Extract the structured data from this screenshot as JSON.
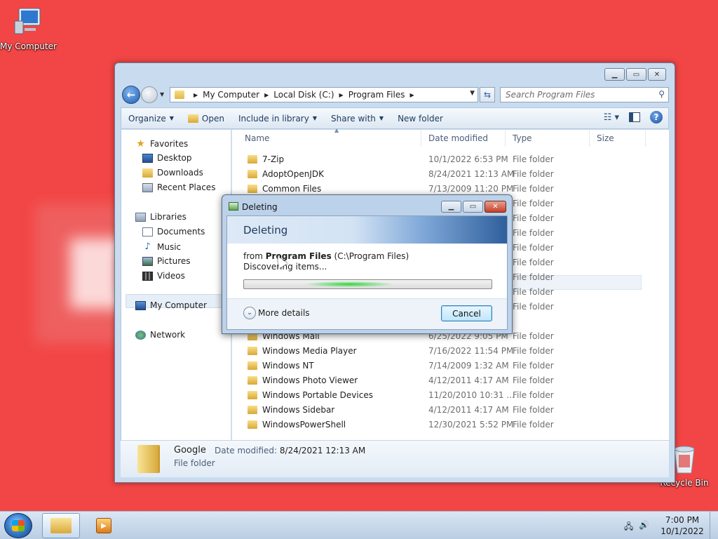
{
  "desktop": {
    "icons": [
      {
        "label": "My Computer"
      },
      {
        "label": "Recycle Bin"
      }
    ]
  },
  "explorer": {
    "address": {
      "crumbs": [
        "My Computer",
        "Local Disk (C:)",
        "Program Files"
      ]
    },
    "search": {
      "placeholder": "Search Program Files"
    },
    "toolbar": {
      "organize": "Organize",
      "open": "Open",
      "include_in_library": "Include in library",
      "share_with": "Share with",
      "new_folder": "New folder"
    },
    "nav": {
      "favorites": "Favorites",
      "desktop": "Desktop",
      "downloads": "Downloads",
      "recent_places": "Recent Places",
      "libraries": "Libraries",
      "documents": "Documents",
      "music": "Music",
      "pictures": "Pictures",
      "videos": "Videos",
      "my_computer": "My Computer",
      "network": "Network"
    },
    "columns": {
      "name": "Name",
      "date": "Date modified",
      "type": "Type",
      "size": "Size"
    },
    "files": [
      {
        "name": "7-Zip",
        "date": "10/1/2022 6:53 PM",
        "type": "File folder"
      },
      {
        "name": "AdoptOpenJDK",
        "date": "8/24/2021 12:13 AM",
        "type": "File folder"
      },
      {
        "name": "Common Files",
        "date": "7/13/2009 11:20 PM",
        "type": "File folder"
      }
    ],
    "hidden_type_rows": [
      "File folder",
      "File folder",
      "File folder",
      "File folder",
      "File folder",
      "File folder",
      "File folder",
      "File folder"
    ],
    "files_bottom": [
      {
        "name": "Windows Mail",
        "date": "6/25/2022 9:05 PM",
        "type": "File folder"
      },
      {
        "name": "Windows Media Player",
        "date": "7/16/2022 11:54 PM",
        "type": "File folder"
      },
      {
        "name": "Windows NT",
        "date": "7/14/2009 1:32 AM",
        "type": "File folder"
      },
      {
        "name": "Windows Photo Viewer",
        "date": "4/12/2011 4:17 AM",
        "type": "File folder"
      },
      {
        "name": "Windows Portable Devices",
        "date": "11/20/2010 10:31 ...",
        "type": "File folder"
      },
      {
        "name": "Windows Sidebar",
        "date": "4/12/2011 4:17 AM",
        "type": "File folder"
      },
      {
        "name": "WindowsPowerShell",
        "date": "12/30/2021 5:52 PM",
        "type": "File folder"
      }
    ],
    "details": {
      "name": "Google",
      "type": "File folder",
      "date_label": "Date modified:",
      "date_value": "8/24/2021 12:13 AM"
    }
  },
  "dialog": {
    "title": "Deleting",
    "heading": "Deleting",
    "from_prefix": "from",
    "from_name": "Program Files",
    "from_path": "(C:\\Program Files)",
    "status": "Discovering items...",
    "more_details": "More details",
    "cancel": "Cancel"
  },
  "taskbar": {
    "time": "7:00 PM",
    "date": "10/1/2022"
  }
}
